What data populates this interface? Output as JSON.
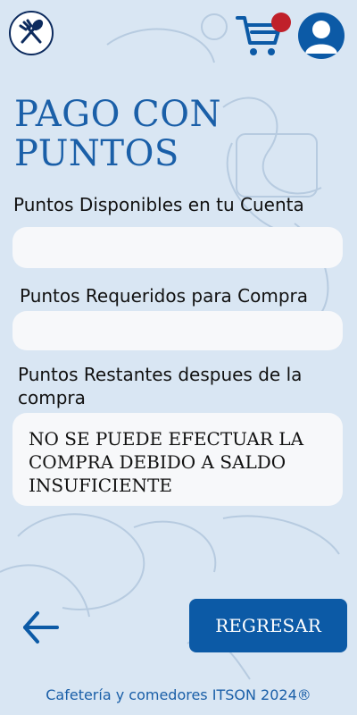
{
  "header": {
    "logo_icon": "fork-spoon-icon",
    "cart_icon": "cart-icon",
    "notification_color": "#c0202a",
    "profile_icon": "user-icon"
  },
  "title": {
    "line1": "PAGO CON",
    "line2": "PUNTOS"
  },
  "fields": {
    "available_label": "Puntos Disponibles en tu Cuenta",
    "available_value": "",
    "required_label": "Puntos Requeridos para Compra",
    "required_value": "",
    "remaining_label": "Puntos Restantes despues de la compra",
    "remaining_message": "NO SE PUEDE EFECTUAR LA COMPRA DEBIDO A SALDO INSUFICIENTE"
  },
  "actions": {
    "back_icon": "arrow-left-icon",
    "back_button_label": "REGRESAR"
  },
  "footer": {
    "text": "Cafetería y comedores ITSON 2024®"
  },
  "colors": {
    "background": "#d9e6f3",
    "primary": "#0c5aa6",
    "title": "#1a5fa8"
  }
}
